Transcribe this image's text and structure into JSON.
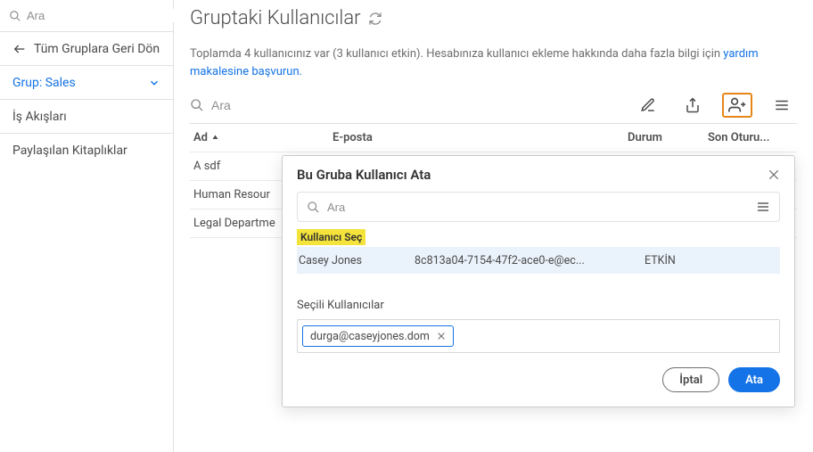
{
  "sidebar": {
    "search_placeholder": "Ara",
    "back_label": "Tüm Gruplara Geri Dön",
    "group_label": "Grup: Sales",
    "items": [
      {
        "label": "İş Akışları"
      },
      {
        "label": "Paylaşılan Kitaplıklar"
      }
    ]
  },
  "page": {
    "title": "Gruptaki Kullanıcılar",
    "help_pre": "Toplamda 4 kullanıcınız var (3 kullanıcı etkin). Hesabınıza kullanıcı ekleme hakkında daha fazla bilgi için ",
    "help_link": "yardım makalesine başvurun.",
    "toolbar_search_placeholder": "Ara"
  },
  "table": {
    "headers": {
      "name": "Ad",
      "email": "E-posta",
      "status": "Durum",
      "last": "Son Oturu..."
    },
    "rows": [
      {
        "name": "A sdf"
      },
      {
        "name": "Human Resour"
      },
      {
        "name": "Legal Departme"
      }
    ]
  },
  "modal": {
    "title": "Bu Gruba Kullanıcı Ata",
    "search_placeholder": "Ara",
    "section_label": "Kullanıcı Seç",
    "row": {
      "name": "Casey Jones",
      "email": "8c813a04-7154-47f2-ace0-e@ec...",
      "status": "ETKİN"
    },
    "selected_label": "Seçili Kullanıcılar",
    "chip_value": "durga@caseyjones.dom",
    "cancel": "İptal",
    "assign": "Ata"
  }
}
